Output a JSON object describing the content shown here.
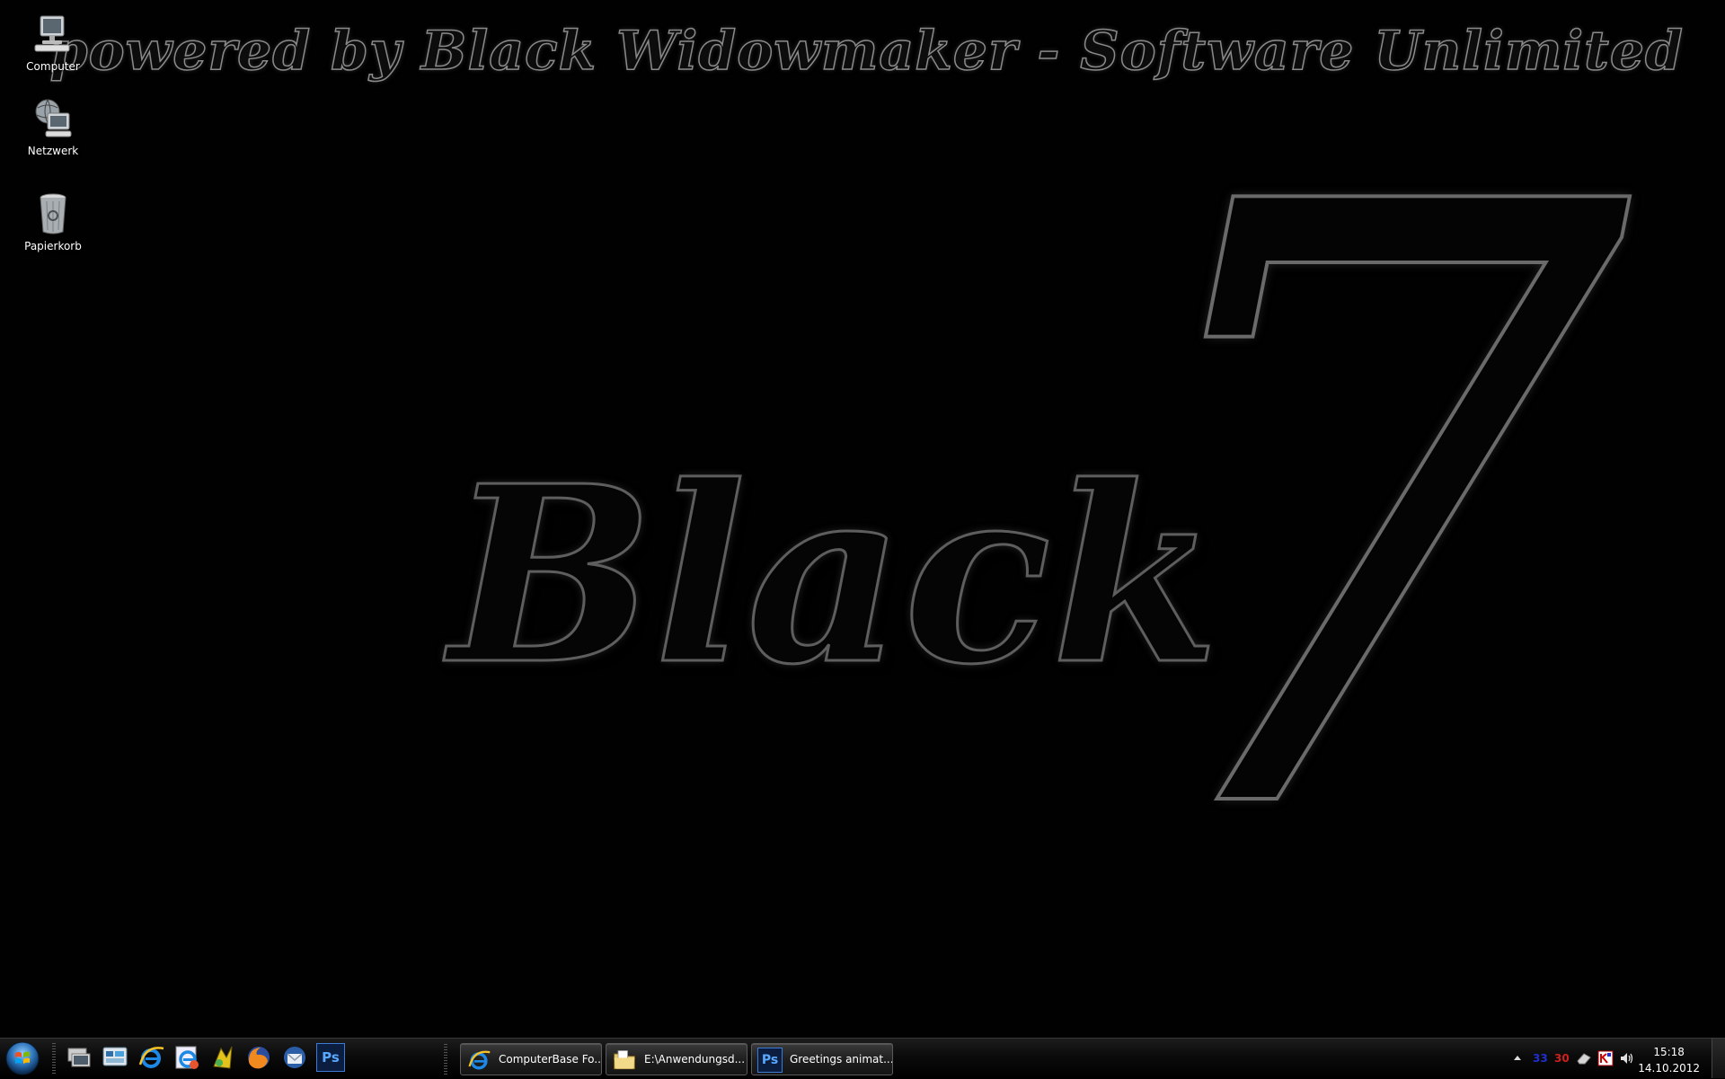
{
  "wallpaper": {
    "tagline": "powered by Black Widowmaker - Software Unlimited",
    "word": "Black",
    "number": "7"
  },
  "desktop_icons": [
    {
      "label": "Computer",
      "icon": "computer-icon"
    },
    {
      "label": "Netzwerk",
      "icon": "network-icon"
    },
    {
      "label": "Papierkorb",
      "icon": "recycle-bin-icon"
    }
  ],
  "quick_launch": [
    {
      "icon": "show-desktop-icon"
    },
    {
      "icon": "switch-windows-icon"
    },
    {
      "icon": "internet-explorer-icon"
    },
    {
      "icon": "internet-explorer-alt-icon"
    },
    {
      "icon": "media-tool-icon"
    },
    {
      "icon": "firefox-icon"
    },
    {
      "icon": "thunderbird-icon"
    },
    {
      "icon": "photoshop-icon",
      "text": "Ps"
    }
  ],
  "taskbar_buttons": [
    {
      "label": "ComputerBase Fo...",
      "icon": "internet-explorer-icon"
    },
    {
      "label": "E:\\Anwendungsd...",
      "icon": "folder-icon"
    },
    {
      "label": "Greetings animat...",
      "icon": "photoshop-icon",
      "icon_text": "Ps"
    }
  ],
  "tray": {
    "items": [
      {
        "text": "33",
        "color": "#1f2fd0"
      },
      {
        "text": "30",
        "color": "#d01f1f"
      }
    ],
    "clock_time": "15:18",
    "clock_date": "14.10.2012"
  }
}
